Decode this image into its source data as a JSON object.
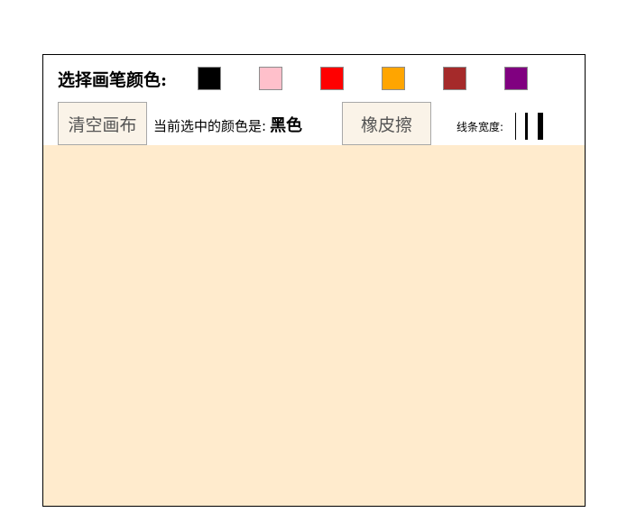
{
  "toolbar": {
    "color_label": "选择画笔颜色:",
    "swatches": [
      {
        "name": "black",
        "color": "#000000"
      },
      {
        "name": "pink",
        "color": "#ffc0cb"
      },
      {
        "name": "red",
        "color": "#ff0000"
      },
      {
        "name": "orange",
        "color": "#ffa500"
      },
      {
        "name": "brown",
        "color": "#a52a2a"
      },
      {
        "name": "purple",
        "color": "#800080"
      }
    ],
    "clear_label": "清空画布",
    "current_label": "当前选中的颜色是:",
    "current_value": "黑色",
    "eraser_label": "橡皮擦",
    "width_label": "线条宽度:",
    "line_widths": [
      {
        "name": "thin",
        "value": 1
      },
      {
        "name": "medium",
        "value": 3
      },
      {
        "name": "thick",
        "value": 6
      }
    ]
  },
  "canvas": {
    "background": "#ffebcd"
  }
}
